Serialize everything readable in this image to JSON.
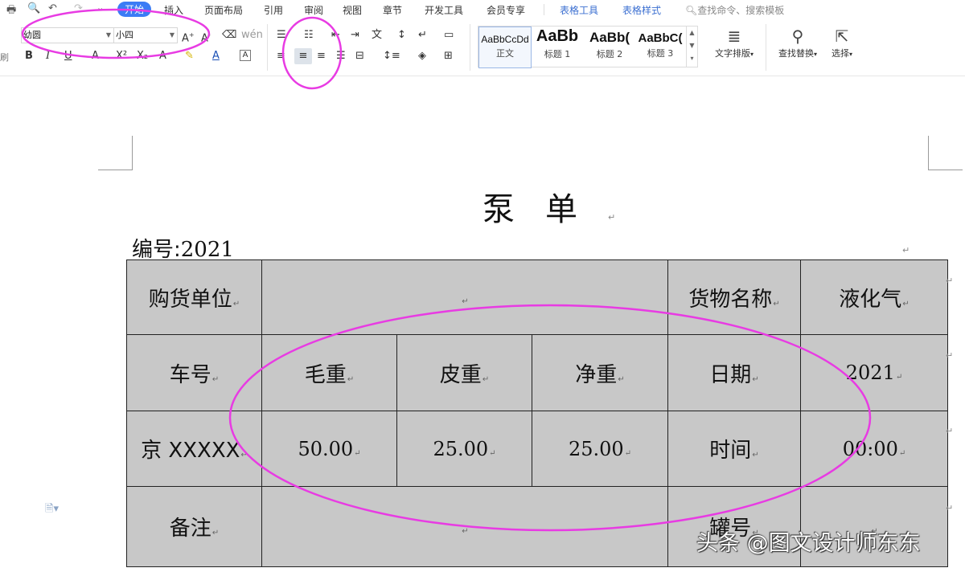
{
  "menu": {
    "quick_access": [
      "🖶",
      "🔍",
      "↶",
      "↷",
      "⌄"
    ],
    "tabs": [
      {
        "label": "开始",
        "active": true
      },
      {
        "label": "插入"
      },
      {
        "label": "页面布局"
      },
      {
        "label": "引用"
      },
      {
        "label": "审阅"
      },
      {
        "label": "视图"
      },
      {
        "label": "章节"
      },
      {
        "label": "开发工具"
      },
      {
        "label": "会员专享"
      },
      {
        "label": "表格工具",
        "contextual": true
      },
      {
        "label": "表格样式",
        "contextual": true
      }
    ],
    "search_placeholder": "查找命令、搜索模板"
  },
  "ribbon": {
    "font_name": "幼圆",
    "font_size": "小四",
    "style_gallery": [
      {
        "preview": "AaBbCcDd",
        "name": "正文",
        "selected": true
      },
      {
        "preview": "AaBb",
        "name": "标题 1"
      },
      {
        "preview": "AaBb(",
        "name": "标题 2"
      },
      {
        "preview": "AaBbC(",
        "name": "标题 3"
      }
    ],
    "text_layout_label": "文字排版",
    "find_replace_label": "查找替换",
    "select_label": "选择"
  },
  "document": {
    "title": "泵单",
    "serial_label": "编号:",
    "serial_value": "2021",
    "table": {
      "row1": {
        "c1": "购货单位",
        "c2": "",
        "c3": "货物名称",
        "c4": "液化气"
      },
      "row2": {
        "c1": "车号",
        "c2": "毛重",
        "c3": "皮重",
        "c4": "净重",
        "c5": "日期",
        "c6": "2021"
      },
      "row3": {
        "c1": "京 XXXXX",
        "c2": "50.00",
        "c3": "25.00",
        "c4": "25.00",
        "c5": "时间",
        "c6": "00:00"
      },
      "row4": {
        "c1": "备注",
        "c2": "",
        "c3": "罐号",
        "c4": ""
      }
    }
  },
  "watermark": "头条 @图文设计师东东",
  "annotation_color": "#e83be3",
  "accent_color": "#3b7cf5"
}
